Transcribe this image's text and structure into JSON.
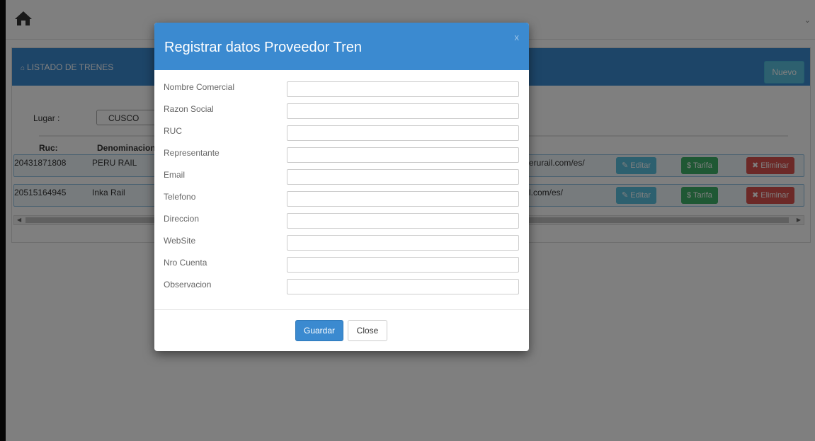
{
  "topbar": {
    "home_icon": "home-icon",
    "chevron": "⌄"
  },
  "panel": {
    "title": "LISTADO DE TRENES",
    "title_icon": "home-icon",
    "new_button": "Nuevo"
  },
  "filter": {
    "label": "Lugar :",
    "value": "CUSCO"
  },
  "table": {
    "headers": [
      "Ruc:",
      "Denominacion"
    ],
    "rows": [
      {
        "ruc": "20431871808",
        "name": "PERU RAIL",
        "website": "erurail.com/es/"
      },
      {
        "ruc": "20515164945",
        "name": "Inka Rail",
        "website": "l.com/es/"
      }
    ],
    "actions": {
      "edit": "Editar",
      "tariff": "Tarifa",
      "delete": "Eliminar",
      "edit_icon": "edit-icon",
      "tariff_icon": "$",
      "delete_icon": "✖"
    }
  },
  "modal": {
    "title": "Registrar datos Proveedor Tren",
    "close_x": "x",
    "fields": [
      {
        "label": "Nombre Comercial",
        "value": ""
      },
      {
        "label": "Razon Social",
        "value": ""
      },
      {
        "label": "RUC",
        "value": ""
      },
      {
        "label": "Representante",
        "value": ""
      },
      {
        "label": "Email",
        "value": ""
      },
      {
        "label": "Telefono",
        "value": ""
      },
      {
        "label": "Direccion",
        "value": ""
      },
      {
        "label": "WebSite",
        "value": ""
      },
      {
        "label": "Nro Cuenta",
        "value": ""
      },
      {
        "label": "Observacion",
        "value": ""
      }
    ],
    "save_button": "Guardar",
    "close_button": "Close"
  },
  "colors": {
    "primary": "#3b8ad0",
    "info": "#5bc0de",
    "success": "#3fb168",
    "danger": "#d9534f"
  }
}
